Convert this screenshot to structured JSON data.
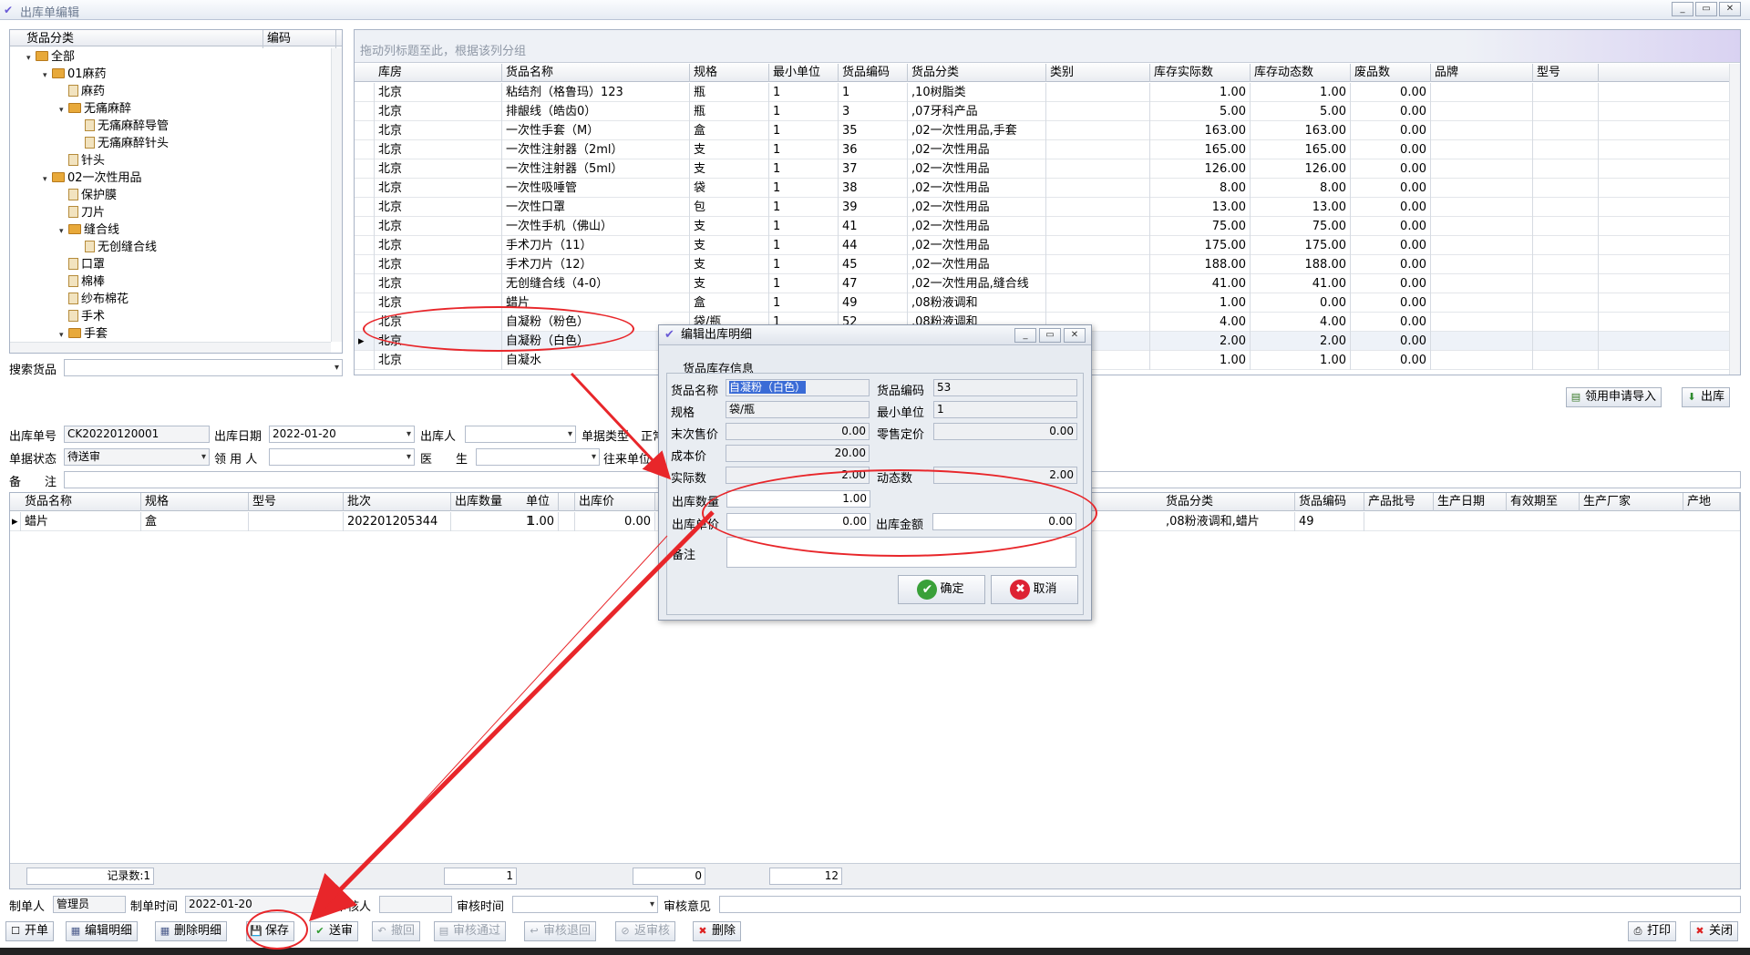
{
  "window": {
    "title": "出库单编辑",
    "min": "_",
    "restore": "▭",
    "close": "✕"
  },
  "tree": {
    "headers": [
      "货品分类",
      "编码"
    ],
    "items": [
      {
        "label": "全部",
        "level": 0,
        "expand": "▾",
        "type": "folder"
      },
      {
        "label": "01麻药",
        "level": 1,
        "expand": "▾",
        "type": "folder"
      },
      {
        "label": "麻药",
        "level": 2,
        "expand": "",
        "type": "doc"
      },
      {
        "label": "无痛麻醉",
        "level": 2,
        "expand": "▾",
        "type": "folder"
      },
      {
        "label": "无痛麻醉导管",
        "level": 3,
        "expand": "",
        "type": "doc"
      },
      {
        "label": "无痛麻醉针头",
        "level": 3,
        "expand": "",
        "type": "doc"
      },
      {
        "label": "针头",
        "level": 2,
        "expand": "",
        "type": "doc"
      },
      {
        "label": "02一次性用品",
        "level": 1,
        "expand": "▾",
        "type": "folder"
      },
      {
        "label": "保护膜",
        "level": 2,
        "expand": "",
        "type": "doc"
      },
      {
        "label": "刀片",
        "level": 2,
        "expand": "",
        "type": "doc"
      },
      {
        "label": "缝合线",
        "level": 2,
        "expand": "▾",
        "type": "folder"
      },
      {
        "label": "无创缝合线",
        "level": 3,
        "expand": "",
        "type": "doc"
      },
      {
        "label": "口罩",
        "level": 2,
        "expand": "",
        "type": "doc"
      },
      {
        "label": "棉棒",
        "level": 2,
        "expand": "",
        "type": "doc"
      },
      {
        "label": "纱布棉花",
        "level": 2,
        "expand": "",
        "type": "doc"
      },
      {
        "label": "手术",
        "level": 2,
        "expand": "",
        "type": "doc"
      },
      {
        "label": "手套",
        "level": 2,
        "expand": "▾",
        "type": "folder"
      }
    ]
  },
  "search": {
    "label": "搜索货品",
    "value": ""
  },
  "stock_grid": {
    "group_hint": "拖动列标题至此，根据该列分组",
    "headers": [
      "库房",
      "货品名称",
      "规格",
      "最小单位",
      "货品编码",
      "货品分类",
      "类别",
      "库存实际数",
      "库存动态数",
      "废品数",
      "品牌",
      "型号"
    ],
    "rows": [
      [
        "北京",
        "粘结剂（格鲁玛）123",
        "瓶",
        "1",
        "1",
        ",10树脂类",
        "",
        "1.00",
        "1.00",
        "0.00",
        "",
        ""
      ],
      [
        "北京",
        "排龈线（皓齿0）",
        "瓶",
        "1",
        "3",
        ",07牙科产品",
        "",
        "5.00",
        "5.00",
        "0.00",
        "",
        ""
      ],
      [
        "北京",
        "一次性手套（M）",
        "盒",
        "1",
        "35",
        ",02一次性用品,手套",
        "",
        "163.00",
        "163.00",
        "0.00",
        "",
        ""
      ],
      [
        "北京",
        "一次性注射器（2ml）",
        "支",
        "1",
        "36",
        ",02一次性用品",
        "",
        "165.00",
        "165.00",
        "0.00",
        "",
        ""
      ],
      [
        "北京",
        "一次性注射器（5ml）",
        "支",
        "1",
        "37",
        ",02一次性用品",
        "",
        "126.00",
        "126.00",
        "0.00",
        "",
        ""
      ],
      [
        "北京",
        "一次性吸唾管",
        "袋",
        "1",
        "38",
        ",02一次性用品",
        "",
        "8.00",
        "8.00",
        "0.00",
        "",
        ""
      ],
      [
        "北京",
        "一次性口罩",
        "包",
        "1",
        "39",
        ",02一次性用品",
        "",
        "13.00",
        "13.00",
        "0.00",
        "",
        ""
      ],
      [
        "北京",
        "一次性手机（佛山）",
        "支",
        "1",
        "41",
        ",02一次性用品",
        "",
        "75.00",
        "75.00",
        "0.00",
        "",
        ""
      ],
      [
        "北京",
        "手术刀片（11）",
        "支",
        "1",
        "44",
        ",02一次性用品",
        "",
        "175.00",
        "175.00",
        "0.00",
        "",
        ""
      ],
      [
        "北京",
        "手术刀片（12）",
        "支",
        "1",
        "45",
        ",02一次性用品",
        "",
        "188.00",
        "188.00",
        "0.00",
        "",
        ""
      ],
      [
        "北京",
        "无创缝合线（4-0）",
        "支",
        "1",
        "47",
        ",02一次性用品,缝合线",
        "",
        "41.00",
        "41.00",
        "0.00",
        "",
        ""
      ],
      [
        "北京",
        "蜡片",
        "盒",
        "1",
        "49",
        ",08粉液调和",
        "",
        "1.00",
        "0.00",
        "0.00",
        "",
        ""
      ],
      [
        "北京",
        "自凝粉（粉色）",
        "袋/瓶",
        "1",
        "52",
        ",08粉液调和",
        "",
        "4.00",
        "4.00",
        "0.00",
        "",
        ""
      ],
      [
        "北京",
        "自凝粉（白色）",
        "",
        "",
        "",
        "",
        "",
        "2.00",
        "2.00",
        "0.00",
        "",
        ""
      ],
      [
        "北京",
        "自凝水",
        "",
        "",
        "",
        "",
        "",
        "1.00",
        "1.00",
        "0.00",
        "",
        ""
      ]
    ]
  },
  "actions": {
    "import": "领用申请导入",
    "out": "出库"
  },
  "form": {
    "order_no_label": "出库单号",
    "order_no": "CK20220120001",
    "date_label": "出库日期",
    "date": "2022-01-20",
    "person_label": "出库人",
    "person": "",
    "type_label": "单据类型",
    "type": "正常",
    "status_label": "单据状态",
    "status": "待送审",
    "user_label": "领 用 人",
    "user": "",
    "doctor_label": "医　　生",
    "doctor": "",
    "unit_label": "往来单位",
    "remark_label": "备　　注",
    "remark": ""
  },
  "detail_grid": {
    "headers": [
      "货品名称",
      "规格",
      "型号",
      "批次",
      "出库数量",
      "单位",
      "出库价",
      "金额"
    ],
    "headers_right": [
      "货品分类",
      "货品编码",
      "产品批号",
      "生产日期",
      "有效期至",
      "生产厂家",
      "产地"
    ],
    "rows": [
      {
        "name": "蜡片",
        "spec": "盒",
        "model": "",
        "batch": "202201205344",
        "qty": "1.00",
        "unit": "1",
        "price": "0.00",
        "category": ",08粉液调和,蜡片",
        "code": "49"
      }
    ],
    "footer": {
      "count": "记录数:1",
      "qty_sum": "1",
      "price_sum": "0",
      "code_sum": "12"
    }
  },
  "audit": {
    "maker_label": "制单人",
    "maker": "管理员",
    "make_time_label": "制单时间",
    "make_time": "2022-01-20",
    "auditor_label": "审核人",
    "auditor": "",
    "audit_time_label": "审核时间",
    "audit_time": "",
    "opinion_label": "审核意见",
    "opinion": ""
  },
  "toolbar": {
    "new": "开单",
    "edit": "编辑明细",
    "del_detail": "删除明细",
    "save": "保存",
    "send": "送审",
    "revoke": "撤回",
    "approve": "审核通过",
    "reject": "审核退回",
    "unapprove": "返审核",
    "delete": "删除",
    "print": "打印",
    "close": "关闭"
  },
  "dialog": {
    "title": "编辑出库明细",
    "group": "货品库存信息",
    "name_label": "货品名称",
    "name": "自凝粉（白色）",
    "code_label": "货品编码",
    "code": "53",
    "spec_label": "规格",
    "spec": "袋/瓶",
    "min_unit_label": "最小单位",
    "min_unit": "1",
    "last_price_label": "末次售价",
    "last_price": "0.00",
    "retail_label": "零售定价",
    "retail": "0.00",
    "cost_label": "成本价",
    "cost": "20.00",
    "actual_label": "实际数",
    "actual": "2.00",
    "dynamic_label": "动态数",
    "dynamic": "2.00",
    "qty_label": "出库数量",
    "qty": "1.00",
    "price_label": "出库单价",
    "price": "0.00",
    "amount_label": "出库金额",
    "amount": "0.00",
    "remark_label": "备注",
    "ok": "确定",
    "cancel": "取消"
  },
  "colors": {
    "annotation": "#e8262a",
    "accent": "#6a5bd6"
  }
}
